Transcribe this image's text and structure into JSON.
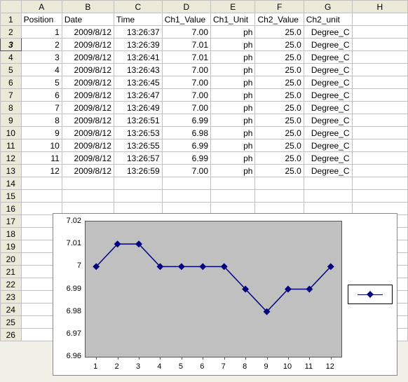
{
  "columns": [
    "A",
    "B",
    "C",
    "D",
    "E",
    "F",
    "G",
    "H"
  ],
  "headers": {
    "A": "Position",
    "B": "Date",
    "C": "Time",
    "D": "Ch1_Value",
    "E": "Ch1_Unit",
    "F": "Ch2_Value",
    "G": "Ch2_unit"
  },
  "selected_row": 3,
  "rows": [
    {
      "pos": "1",
      "date": "2009/8/12",
      "time": "13:26:37",
      "v1": "7.00",
      "u1": "ph",
      "v2": "25.0",
      "u2": "Degree_C"
    },
    {
      "pos": "2",
      "date": "2009/8/12",
      "time": "13:26:39",
      "v1": "7.01",
      "u1": "ph",
      "v2": "25.0",
      "u2": "Degree_C"
    },
    {
      "pos": "3",
      "date": "2009/8/12",
      "time": "13:26:41",
      "v1": "7.01",
      "u1": "ph",
      "v2": "25.0",
      "u2": "Degree_C"
    },
    {
      "pos": "4",
      "date": "2009/8/12",
      "time": "13:26:43",
      "v1": "7.00",
      "u1": "ph",
      "v2": "25.0",
      "u2": "Degree_C"
    },
    {
      "pos": "5",
      "date": "2009/8/12",
      "time": "13:26:45",
      "v1": "7.00",
      "u1": "ph",
      "v2": "25.0",
      "u2": "Degree_C"
    },
    {
      "pos": "6",
      "date": "2009/8/12",
      "time": "13:26:47",
      "v1": "7.00",
      "u1": "ph",
      "v2": "25.0",
      "u2": "Degree_C"
    },
    {
      "pos": "7",
      "date": "2009/8/12",
      "time": "13:26:49",
      "v1": "7.00",
      "u1": "ph",
      "v2": "25.0",
      "u2": "Degree_C"
    },
    {
      "pos": "8",
      "date": "2009/8/12",
      "time": "13:26:51",
      "v1": "6.99",
      "u1": "ph",
      "v2": "25.0",
      "u2": "Degree_C"
    },
    {
      "pos": "9",
      "date": "2009/8/12",
      "time": "13:26:53",
      "v1": "6.98",
      "u1": "ph",
      "v2": "25.0",
      "u2": "Degree_C"
    },
    {
      "pos": "10",
      "date": "2009/8/12",
      "time": "13:26:55",
      "v1": "6.99",
      "u1": "ph",
      "v2": "25.0",
      "u2": "Degree_C"
    },
    {
      "pos": "11",
      "date": "2009/8/12",
      "time": "13:26:57",
      "v1": "6.99",
      "u1": "ph",
      "v2": "25.0",
      "u2": "Degree_C"
    },
    {
      "pos": "12",
      "date": "2009/8/12",
      "time": "13:26:59",
      "v1": "7.00",
      "u1": "ph",
      "v2": "25.0",
      "u2": "Degree_C"
    }
  ],
  "empty_rows_after": [
    14,
    15,
    16,
    17,
    18,
    19,
    20,
    21,
    22,
    23,
    24,
    25,
    26
  ],
  "chart_data": {
    "type": "line",
    "categories": [
      1,
      2,
      3,
      4,
      5,
      6,
      7,
      8,
      9,
      10,
      11,
      12
    ],
    "values": [
      7.0,
      7.01,
      7.01,
      7.0,
      7.0,
      7.0,
      7.0,
      6.99,
      6.98,
      6.99,
      6.99,
      7.0
    ],
    "ylim": [
      6.96,
      7.02
    ],
    "yticks": [
      6.96,
      6.97,
      6.98,
      6.99,
      7.0,
      7.01,
      7.02
    ],
    "ytick_labels": [
      "6.96",
      "6.97",
      "6.98",
      "6.99",
      "7",
      "7.01",
      "7.02"
    ],
    "series_color": "#000080"
  }
}
